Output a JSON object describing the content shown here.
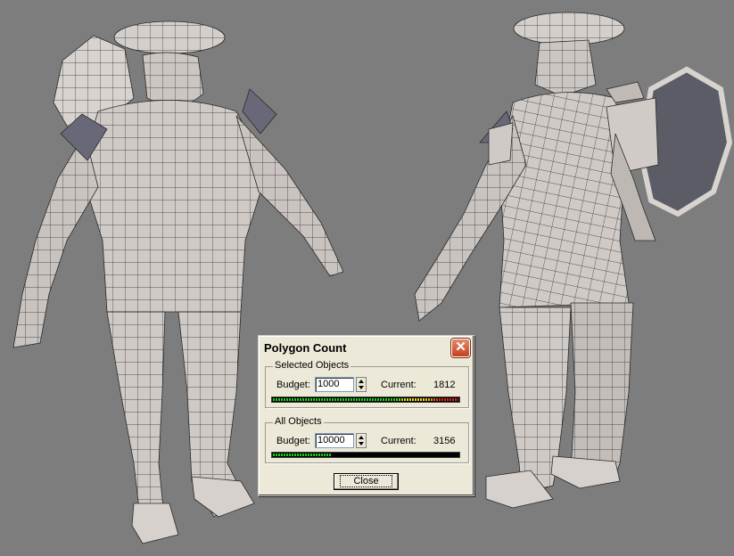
{
  "dialog": {
    "title": "Polygon Count",
    "selected_group": {
      "label": "Selected Objects",
      "budget_label": "Budget:",
      "budget_value": "1000",
      "current_label": "Current:",
      "current_value": "1812",
      "meter_fraction": 1.0
    },
    "all_group": {
      "label": "All Objects",
      "budget_label": "Budget:",
      "budget_value": "10000",
      "current_label": "Current:",
      "current_value": "3156",
      "meter_fraction": 0.3156
    },
    "close_label": "Close"
  },
  "colors": {
    "viewport_bg": "#7d7d7d",
    "mesh_fill": "#cfcac6",
    "mesh_shadow": "#a9a4a2",
    "meter_green": "#1ec81e",
    "meter_yellow": "#e8d820",
    "meter_red": "#d42a1a"
  }
}
